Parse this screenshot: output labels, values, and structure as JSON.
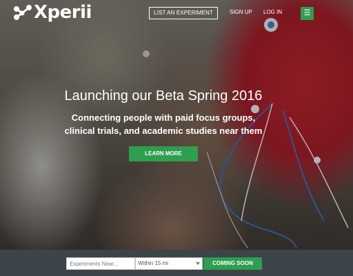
{
  "brand": {
    "logo_text": "Xperii",
    "logo_icon": "molecule-icon"
  },
  "nav": {
    "list_experiment": "LIST AN EXPERIMENT",
    "sign_up": "SIGN UP",
    "log_in": "LOG IN",
    "menu_icon": "hamburger-menu-icon",
    "menu_glyph": "☰"
  },
  "hero": {
    "headline": "Launching our Beta Spring 2016",
    "subline_1": "Connecting people with paid focus groups,",
    "subline_2": "clinical trials, and academic studies near them",
    "cta": "LEARN MORE"
  },
  "search": {
    "placeholder": "Experiments Near...",
    "distance": "Within 15 mi",
    "button": "COMING SOON"
  },
  "colors": {
    "accent_green": "#2e9e4f",
    "search_bar_bg": "#3d4449"
  }
}
